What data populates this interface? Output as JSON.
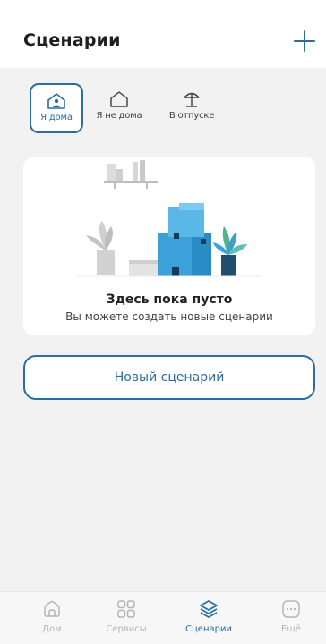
{
  "header": {
    "title": "Сценарии"
  },
  "modes": [
    {
      "label": "Я дома",
      "icon": "home-person-icon",
      "active": true
    },
    {
      "label": "Я не дома",
      "icon": "home-icon",
      "active": false
    },
    {
      "label": "В отпуске",
      "icon": "beach-umbrella-icon",
      "active": false
    }
  ],
  "empty_state": {
    "title": "Здесь пока пусто",
    "subtitle": "Вы можете создать новые сценарии"
  },
  "new_scenario_label": "Новый сценарий",
  "bottom_nav": [
    {
      "label": "Дом",
      "icon": "home-nav-icon",
      "active": false
    },
    {
      "label": "Сервисы",
      "icon": "grid-icon",
      "active": false
    },
    {
      "label": "Сценарии",
      "icon": "layers-icon",
      "active": true
    },
    {
      "label": "Ещё",
      "icon": "more-icon",
      "active": false
    }
  ],
  "colors": {
    "accent": "#2a6da3",
    "inactive": "#b5b5b5",
    "background": "#f2f2f2"
  }
}
